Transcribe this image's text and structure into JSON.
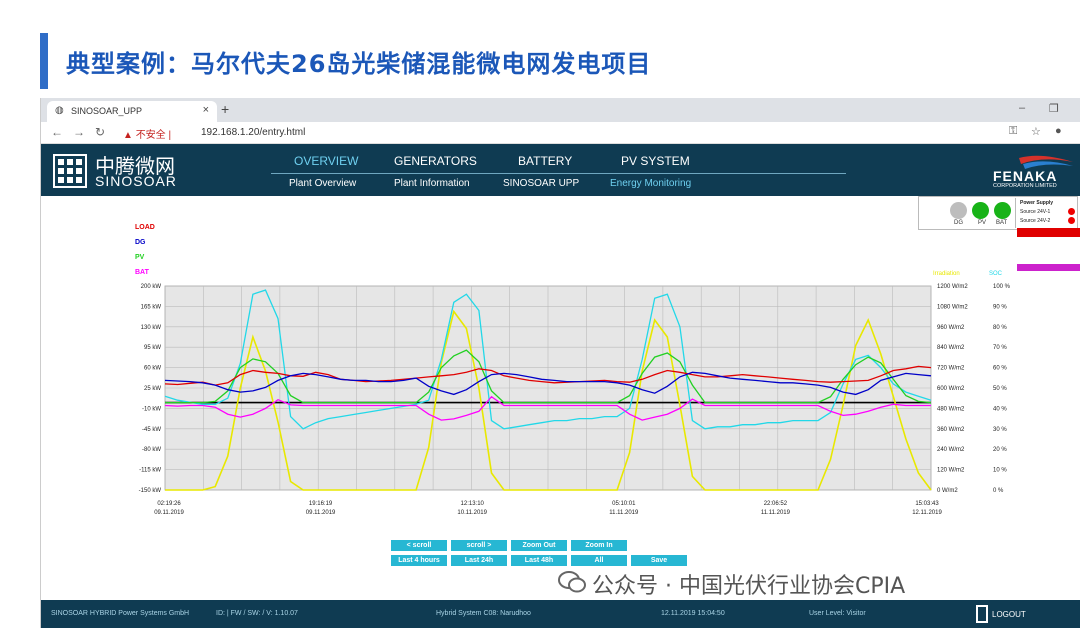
{
  "slide": {
    "title": "典型案例：马尔代夫26岛光柴储混能微电网发电项目"
  },
  "browser": {
    "tab_title": "SINOSOAR_UPP",
    "security_warning": "不安全",
    "url": "192.168.1.20/entry.html"
  },
  "header": {
    "logo_cn": "中腾微网",
    "logo_en": "SINOSOAR",
    "main_nav": [
      "OVERVIEW",
      "GENERATORS",
      "BATTERY",
      "PV SYSTEM"
    ],
    "sub_nav": [
      "Plant Overview",
      "Plant Information",
      "SINOSOAR UPP",
      "Energy Monitoring"
    ],
    "brand_name": "FENAKA",
    "brand_sub": "CORPORATION LIMITED"
  },
  "power_supply": {
    "indicators": [
      {
        "label": "DG",
        "color": "#bdbdbd"
      },
      {
        "label": "PV",
        "color": "#18b318"
      },
      {
        "label": "BAT",
        "color": "#18b318"
      }
    ],
    "title": "Power Supply",
    "sources": [
      "Source 24V-1",
      "Source 24V-2"
    ],
    "alarm_color": "#e00000"
  },
  "chart_data": {
    "type": "line",
    "legend": [
      "LOAD",
      "DG",
      "PV",
      "BAT"
    ],
    "legend_colors": [
      "#e00000",
      "#0000c8",
      "#22d022",
      "#ff00ff"
    ],
    "right_headers": [
      "Irradiation",
      "SOC"
    ],
    "right_header_colors": [
      "#e8e800",
      "#22d8e8"
    ],
    "y_left": [
      "200 kW",
      "165 kW",
      "130 kW",
      "95 kW",
      "60 kW",
      "25 kW",
      "-10 kW",
      "-45 kW",
      "-80 kW",
      "-115 kW",
      "-150 kW"
    ],
    "y_irr": [
      "1200 W/m2",
      "1080 W/m2",
      "960 W/m2",
      "840 W/m2",
      "720 W/m2",
      "600 W/m2",
      "480 W/m2",
      "360 W/m2",
      "240 W/m2",
      "120 W/m2",
      "0 W/m2"
    ],
    "y_soc": [
      "100 %",
      "90 %",
      "80 %",
      "70 %",
      "60 %",
      "50 %",
      "40 %",
      "30 %",
      "20 %",
      "10 %",
      "0 %"
    ],
    "ylim_kw": [
      -150,
      200
    ],
    "x_ticks": [
      {
        "time": "02:19:26",
        "date": "09.11.2019"
      },
      {
        "time": "19:16:19",
        "date": "09.11.2019"
      },
      {
        "time": "12:13:10",
        "date": "10.11.2019"
      },
      {
        "time": "05:10:01",
        "date": "11.11.2019"
      },
      {
        "time": "22:06:52",
        "date": "11.11.2019"
      },
      {
        "time": "15:03:43",
        "date": "12.11.2019"
      }
    ],
    "grid": true,
    "series": [
      {
        "name": "LOAD",
        "values": [
          32,
          31,
          33,
          35,
          30,
          34,
          48,
          55,
          52,
          50,
          46,
          45,
          52,
          48,
          40,
          38,
          36,
          37,
          38,
          40,
          42,
          44,
          46,
          48,
          52,
          58,
          55,
          46,
          42,
          38,
          36,
          34,
          35,
          36,
          37,
          38,
          36,
          35,
          40,
          48,
          55,
          52,
          48,
          44,
          44,
          46,
          48,
          46,
          44,
          42,
          40,
          38,
          36,
          35,
          36,
          37,
          38,
          46,
          55,
          58,
          62,
          60
        ]
      },
      {
        "name": "DG",
        "values": [
          38,
          37,
          36,
          34,
          30,
          22,
          18,
          20,
          26,
          38,
          46,
          50,
          48,
          44,
          40,
          38,
          38,
          36,
          36,
          38,
          42,
          28,
          20,
          14,
          22,
          36,
          48,
          50,
          48,
          44,
          40,
          38,
          36,
          36,
          36,
          36,
          34,
          30,
          22,
          16,
          28,
          44,
          52,
          50,
          46,
          42,
          40,
          38,
          36,
          34,
          34,
          32,
          30,
          26,
          18,
          14,
          22,
          38,
          44,
          50,
          48,
          46
        ]
      },
      {
        "name": "PV",
        "values": [
          0,
          0,
          0,
          0,
          2,
          20,
          60,
          75,
          70,
          50,
          12,
          0,
          0,
          0,
          0,
          0,
          0,
          0,
          0,
          0,
          0,
          18,
          60,
          80,
          90,
          70,
          20,
          0,
          0,
          0,
          0,
          0,
          0,
          0,
          0,
          0,
          0,
          12,
          50,
          78,
          85,
          70,
          30,
          0,
          0,
          0,
          0,
          0,
          0,
          0,
          0,
          0,
          0,
          10,
          40,
          65,
          78,
          68,
          40,
          12,
          2,
          0
        ]
      },
      {
        "name": "BAT",
        "values": [
          -5,
          -6,
          -5,
          -5,
          -8,
          -20,
          -25,
          -20,
          -10,
          5,
          -4,
          -5,
          -5,
          -5,
          -5,
          -5,
          -5,
          -5,
          -5,
          -5,
          -5,
          -20,
          -30,
          -28,
          -22,
          -15,
          10,
          -5,
          -5,
          -5,
          -5,
          -5,
          -5,
          -5,
          -5,
          -5,
          -5,
          -20,
          -30,
          -25,
          -20,
          -10,
          6,
          -5,
          -5,
          -5,
          -5,
          -5,
          -5,
          -5,
          -5,
          -5,
          -5,
          -15,
          -22,
          -20,
          -15,
          -8,
          -3,
          -5,
          -5,
          -5
        ]
      },
      {
        "name": "Irradiation",
        "values": [
          0,
          0,
          0,
          0,
          20,
          200,
          600,
          900,
          700,
          400,
          50,
          0,
          0,
          0,
          0,
          0,
          0,
          0,
          0,
          0,
          0,
          250,
          750,
          1050,
          950,
          600,
          100,
          0,
          0,
          0,
          0,
          0,
          0,
          0,
          0,
          0,
          0,
          220,
          700,
          1000,
          900,
          500,
          80,
          0,
          0,
          0,
          0,
          0,
          0,
          0,
          0,
          0,
          0,
          180,
          500,
          850,
          1000,
          800,
          550,
          300,
          100,
          0
        ]
      },
      {
        "name": "SOC",
        "values": [
          46,
          44,
          43,
          42,
          42,
          45,
          62,
          96,
          98,
          84,
          36,
          30,
          33,
          35,
          36,
          37,
          38,
          39,
          40,
          41,
          42,
          44,
          64,
          92,
          96,
          88,
          34,
          30,
          31,
          32,
          33,
          34,
          34,
          35,
          35,
          36,
          36,
          40,
          64,
          94,
          96,
          80,
          34,
          30,
          31,
          31,
          32,
          32,
          33,
          33,
          34,
          34,
          34,
          38,
          52,
          64,
          66,
          60,
          52,
          48,
          46,
          44
        ]
      }
    ]
  },
  "controls": {
    "row1": [
      "< scroll",
      "scroll >",
      "Zoom Out",
      "Zoom In"
    ],
    "row2": [
      "Last 4 hours",
      "Last 24h",
      "Last 48h",
      "All",
      "Save"
    ]
  },
  "status": {
    "company": "SINOSOAR HYBRID Power Systems GmbH",
    "version": "ID:  | FW / SW:  / V: 1.10.07",
    "system": "Hybrid System C08: Narudhoo",
    "datetime": "12.11.2019 15:04:50",
    "user_level": "User Level: Visitor",
    "logout": "LOGOUT"
  },
  "watermark": "公众号 · 中国光伏行业协会CPIA"
}
